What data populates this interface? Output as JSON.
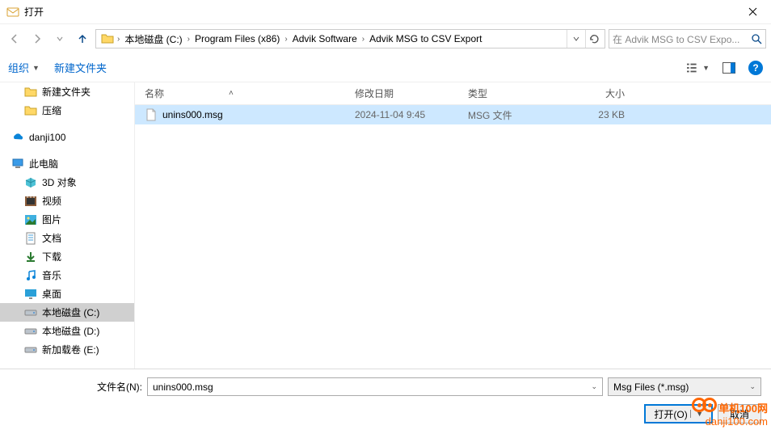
{
  "window": {
    "title": "打开"
  },
  "breadcrumb": {
    "items": [
      "本地磁盘 (C:)",
      "Program Files (x86)",
      "Advik Software",
      "Advik MSG to CSV Export"
    ]
  },
  "search": {
    "placeholder": "在 Advik MSG to CSV Expo..."
  },
  "toolbar": {
    "organize": "组织",
    "new_folder": "新建文件夹"
  },
  "sidebar": {
    "items": [
      {
        "label": "新建文件夹",
        "icon": "folder"
      },
      {
        "label": "压缩",
        "icon": "folder"
      },
      {
        "label": "danji100",
        "icon": "onedrive",
        "top": true
      },
      {
        "label": "此电脑",
        "icon": "pc",
        "top": true
      },
      {
        "label": "3D 对象",
        "icon": "3d"
      },
      {
        "label": "视频",
        "icon": "video"
      },
      {
        "label": "图片",
        "icon": "picture"
      },
      {
        "label": "文档",
        "icon": "doc"
      },
      {
        "label": "下载",
        "icon": "download"
      },
      {
        "label": "音乐",
        "icon": "music"
      },
      {
        "label": "桌面",
        "icon": "desktop"
      },
      {
        "label": "本地磁盘 (C:)",
        "icon": "disk",
        "selected": true
      },
      {
        "label": "本地磁盘 (D:)",
        "icon": "disk"
      },
      {
        "label": "新加载卷 (E:)",
        "icon": "disk"
      }
    ]
  },
  "filelist": {
    "headers": {
      "name": "名称",
      "date": "修改日期",
      "type": "类型",
      "size": "大小"
    },
    "rows": [
      {
        "name": "unins000.msg",
        "date": "2024-11-04 9:45",
        "type": "MSG 文件",
        "size": "23 KB",
        "selected": true
      }
    ]
  },
  "bottom": {
    "filename_label": "文件名(N):",
    "filename_value": "unins000.msg",
    "filter": "Msg Files (*.msg)",
    "open": "打开(O)",
    "cancel": "取消"
  },
  "watermark": {
    "line1": "单机100网",
    "line2": "danji100.com"
  }
}
